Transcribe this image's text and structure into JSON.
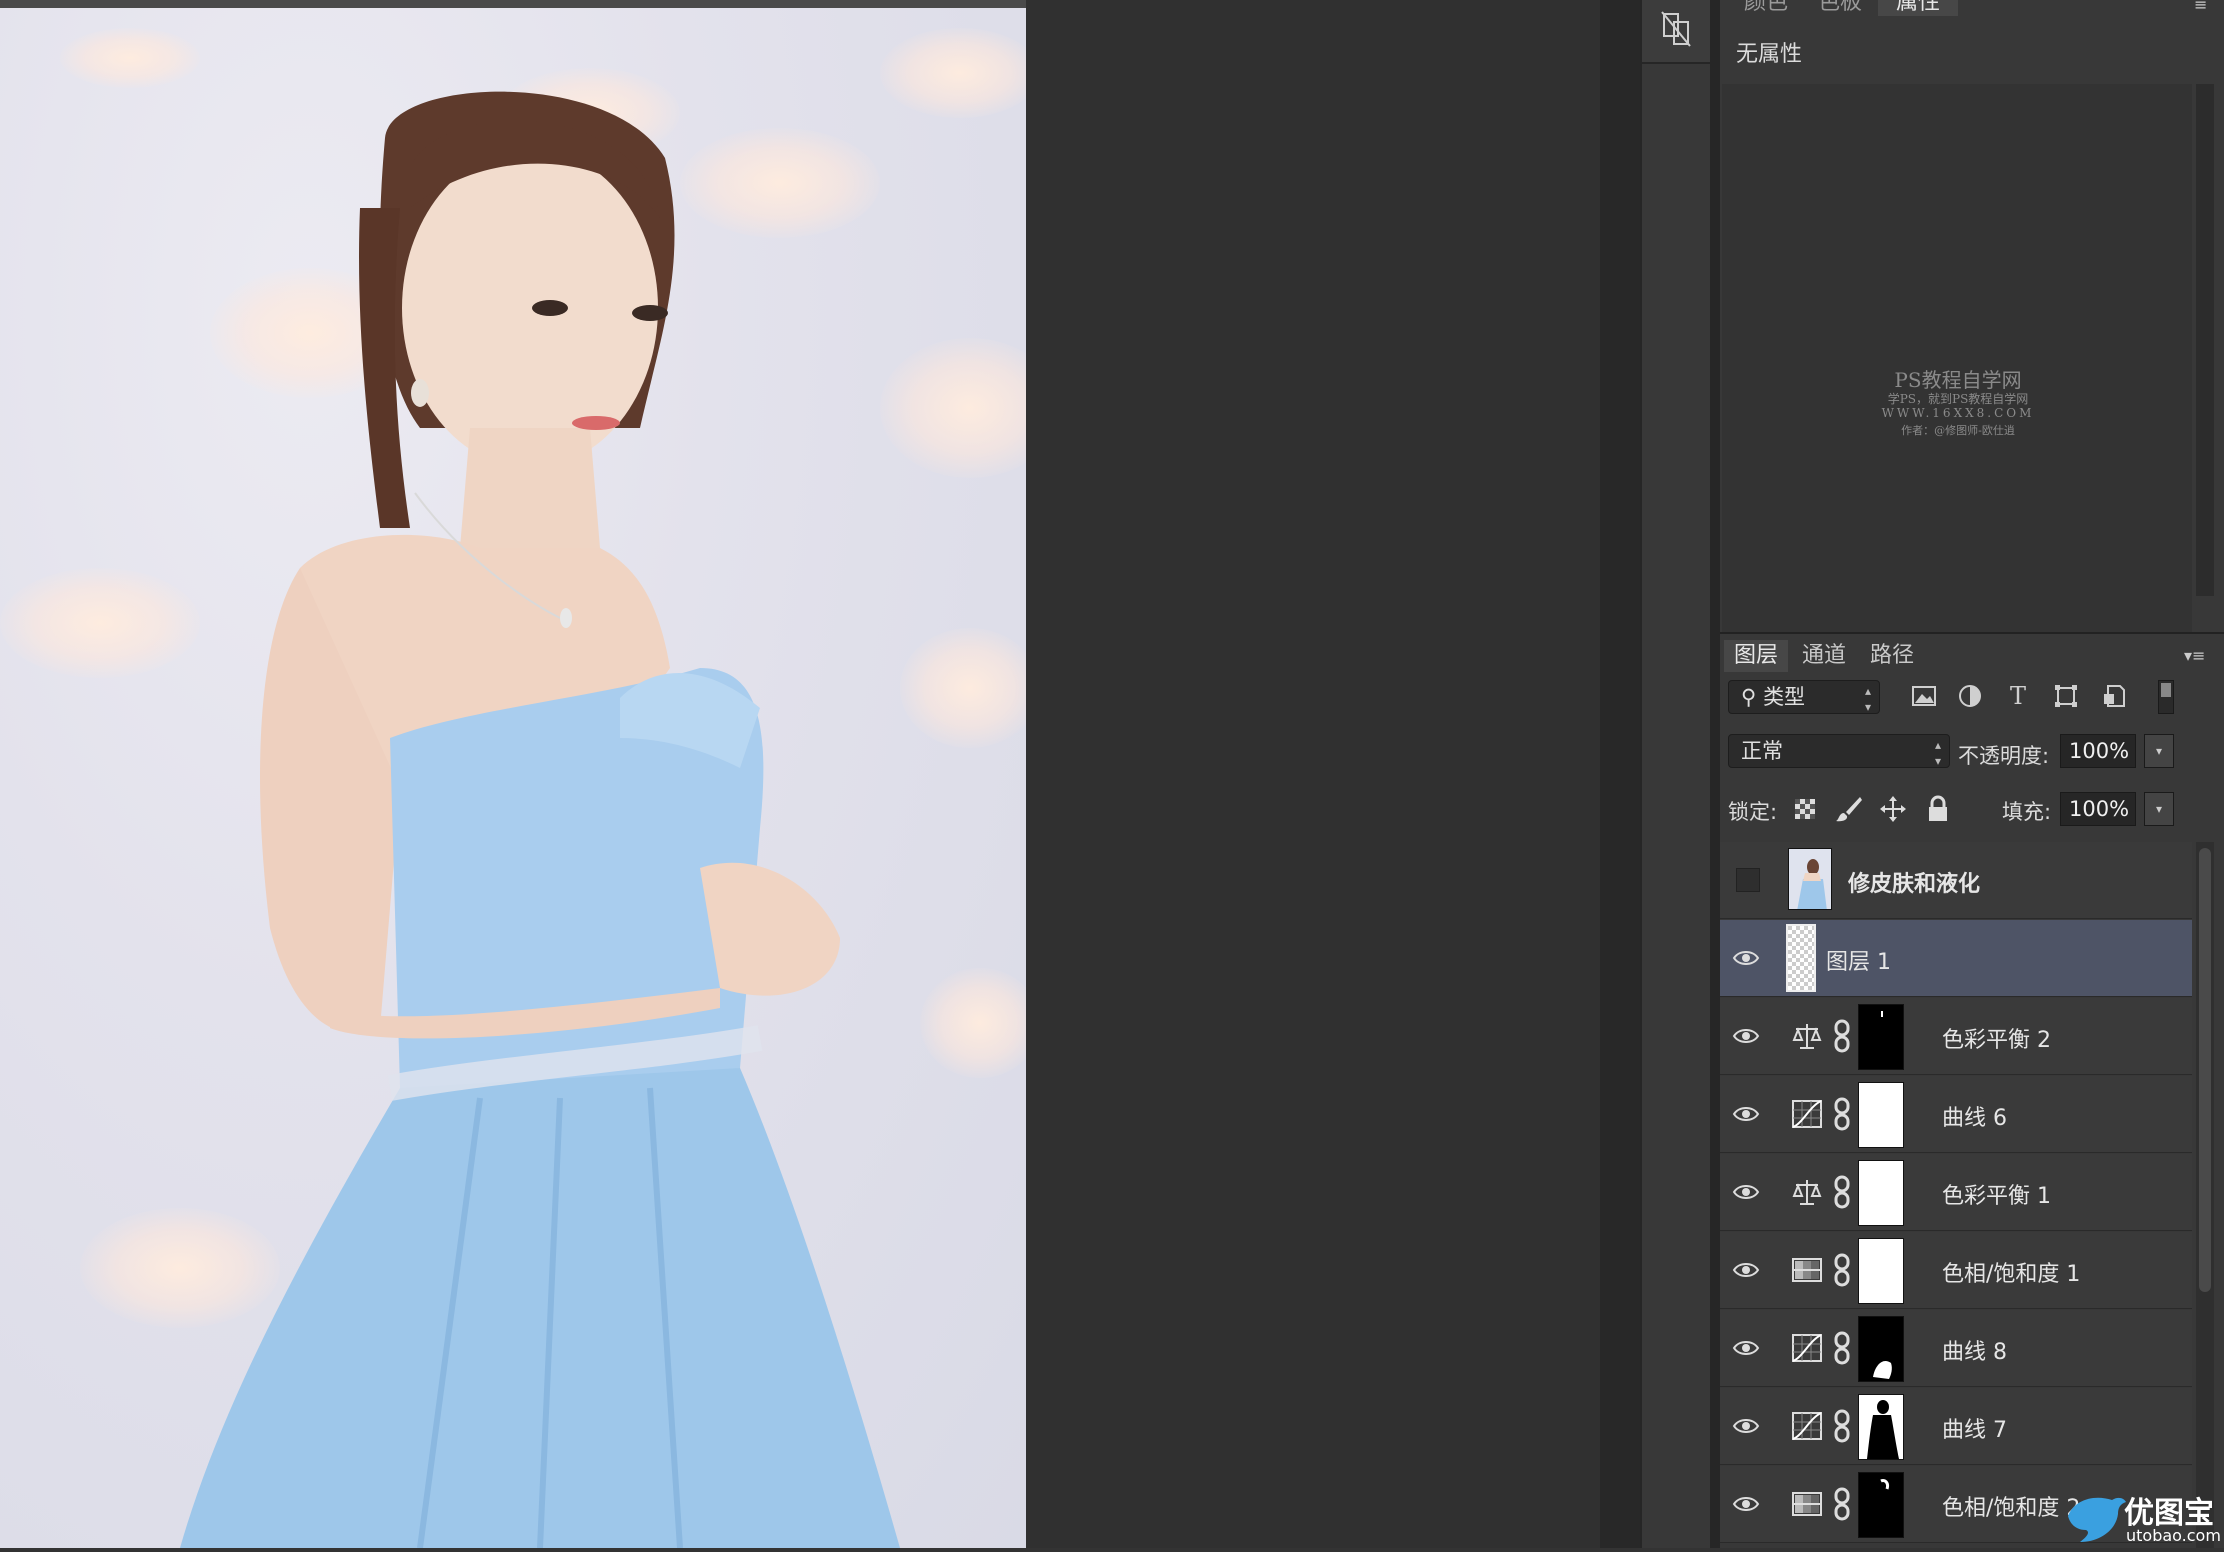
{
  "properties_panel": {
    "tabs": [
      "颜色",
      "色板",
      "属性"
    ],
    "title": "无属性",
    "watermark": {
      "line1": "PS教程自学网",
      "line2": "学PS，就到PS教程自学网",
      "line3": "WWW.16XX8.COM",
      "line4": "作者：@修图师-欧仕逍"
    }
  },
  "layers_panel": {
    "tabs": [
      "图层",
      "通道",
      "路径"
    ],
    "filter": {
      "label": "类型"
    },
    "filter_icons": [
      "image-filter-icon",
      "adjustment-filter-icon",
      "type-filter-icon",
      "shape-filter-icon",
      "smart-object-filter-icon"
    ],
    "blend_mode": "正常",
    "opacity_label": "不透明度:",
    "opacity_value": "100%",
    "lock_label": "锁定:",
    "fill_label": "填充:",
    "fill_value": "100%",
    "layers": [
      {
        "name": "修皮肤和液化",
        "visible": false,
        "type": "pixel"
      },
      {
        "name": "图层 1",
        "visible": true,
        "type": "empty",
        "selected": true
      },
      {
        "name": "色彩平衡 2",
        "visible": true,
        "type": "color-balance",
        "mask": "black"
      },
      {
        "name": "曲线 6",
        "visible": true,
        "type": "curves",
        "mask": "white"
      },
      {
        "name": "色彩平衡 1",
        "visible": true,
        "type": "color-balance",
        "mask": "white"
      },
      {
        "name": "色相/饱和度 1",
        "visible": true,
        "type": "hue-saturation",
        "mask": "white"
      },
      {
        "name": "曲线 8",
        "visible": true,
        "type": "curves",
        "mask": "black"
      },
      {
        "name": "曲线 7",
        "visible": true,
        "type": "curves",
        "mask": "silhouette"
      },
      {
        "name": "色相/饱和度 2",
        "visible": true,
        "type": "hue-saturation",
        "mask": "black"
      }
    ]
  },
  "logo": {
    "main": "优图宝",
    "sub": "utobao.com"
  },
  "colors": {
    "panel": "#383838",
    "selected_row": "#4e5466",
    "workspace": "#303030"
  }
}
